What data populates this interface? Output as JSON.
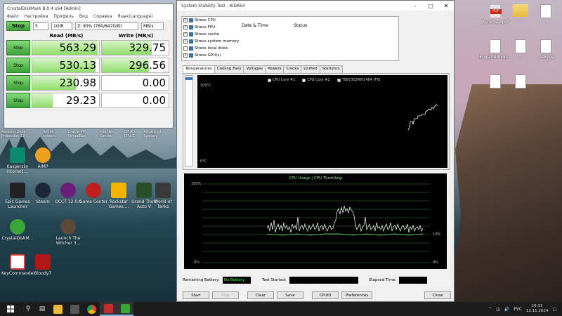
{
  "desktop": {
    "icons_left": [
      {
        "label": "Kaspersky Internet ...",
        "color": "#0a8a6a",
        "icon": "kaspersky-icon"
      },
      {
        "label": "AIMP",
        "color": "#f0a020",
        "icon": "aimp-icon"
      },
      {
        "label": "Epic Games Launcher",
        "color": "#222222",
        "icon": "epic-games-icon"
      },
      {
        "label": "Steam",
        "color": "#1b2838",
        "icon": "steam-icon"
      },
      {
        "label": "OCCT 12.0.0",
        "color": "#6b1f7a",
        "icon": "occt-icon"
      },
      {
        "label": "Game Center",
        "color": "#c02020",
        "icon": "game-center-icon"
      },
      {
        "label": "Rockstar Games ...",
        "color": "#f2b300",
        "icon": "rockstar-icon"
      },
      {
        "label": "Grand Theft Auto V",
        "color": "#2a4d2a",
        "icon": "gta-icon"
      },
      {
        "label": "World of Tanks",
        "color": "#3a3a3a",
        "icon": "wot-icon"
      },
      {
        "label": "CrystalDiskM...",
        "color": "#3aa63a",
        "icon": "crystaldiskmark-icon"
      },
      {
        "label": "Launch The Witcher 3...",
        "color": "#5a4a3a",
        "icon": "witcher-icon"
      },
      {
        "label": "KeyCommander...",
        "color": "#d84040",
        "icon": "keycommander-icon"
      },
      {
        "label": "Bloody7",
        "color": "#b01818",
        "icon": "bloody-icon"
      }
    ],
    "top_row_labels": [
      "Amazon Desk Protection 12",
      "Ashell ... system",
      "Oracle VM VirtualBox",
      "Intel Arc Control",
      "CPUID CPU-Z",
      "Advanced System..."
    ],
    "icons_right": [
      {
        "label": "Купить...pdf",
        "type": "pdf"
      },
      {
        "label": "...",
        "type": "folder"
      },
      {
        "label": "...",
        "type": "file"
      },
      {
        "label": "Epic2ndShop...",
        "type": "file"
      },
      {
        "label": "...",
        "type": "file"
      },
      {
        "label": "...skype",
        "type": "file"
      },
      {
        "label": "...",
        "type": "file"
      },
      {
        "label": "...",
        "type": "file"
      }
    ]
  },
  "cdm": {
    "title": "CrystalDiskMark 8.0.4 x64 [Admin]",
    "menu": [
      "Файл",
      "Настройки",
      "Профиль",
      "Вид",
      "Справка",
      "Язык(Language)"
    ],
    "stop_label": "Stop",
    "count": "5",
    "size": "1GiB",
    "drive": "Z: 90% (780/847GiB)",
    "unit": "MB/s",
    "read_header": "Read (MB/s)",
    "write_header": "Write (MB/s)",
    "rows": [
      {
        "label": "Stop",
        "read": "563.29",
        "write": "329.75",
        "read_pct": 0.98,
        "write_pct": 0.75
      },
      {
        "label": "Stop",
        "read": "530.13",
        "write": "296.56",
        "read_pct": 0.95,
        "write_pct": 0.7
      },
      {
        "label": "Stop",
        "read": "230.98",
        "write": "0.00",
        "read_pct": 0.65,
        "write_pct": 0.0
      },
      {
        "label": "Stop",
        "read": "29.23",
        "write": "0.00",
        "read_pct": 0.3,
        "write_pct": 0.0
      }
    ]
  },
  "ast": {
    "title": "System Stability Test - AIDA64",
    "tests": [
      "Stress CPU",
      "Stress FPU",
      "Stress cache",
      "Stress system memory",
      "Stress local disks",
      "Stress GPU(s)"
    ],
    "col_date": "Date & Time",
    "col_status": "Status",
    "tabs": [
      "Temperatures",
      "Cooling Fans",
      "Voltages",
      "Powers",
      "Clocks",
      "Unified",
      "Statistics"
    ],
    "legend": [
      "CPU Core #1",
      "CPU Core #2",
      "TSB7302MH1484 (F5)"
    ],
    "temp_top": "100°C",
    "temp_bottom": "0°C",
    "cpu_title_a": "CPU Usage",
    "cpu_title_sep": "|",
    "cpu_title_b": "CPU Throttling",
    "cpu_top": "100%",
    "cpu_bottom": "0%",
    "cpu_right_top": "0%",
    "cpu_right_mid": "13%",
    "remaining_battery_label": "Remaining Battery:",
    "remaining_battery_value": "No Battery",
    "test_started_label": "Test Started:",
    "elapsed_time_label": "Elapsed Time:",
    "buttons": [
      "Start",
      "Stop",
      "Clear",
      "Save",
      "CPUID",
      "Preferences",
      "Close"
    ]
  },
  "taskbar": {
    "apps": [
      {
        "name": "start",
        "icon": "windows-icon"
      },
      {
        "name": "search",
        "icon": "search-icon"
      },
      {
        "name": "task-view",
        "icon": "task-view-icon"
      },
      {
        "name": "explorer",
        "icon": "folder-icon",
        "color": "#e8b93e"
      },
      {
        "name": "calculator",
        "icon": "calculator-icon",
        "color": "#444"
      },
      {
        "name": "chrome",
        "icon": "chrome-icon",
        "color": "#4a8df0"
      },
      {
        "name": "aida64",
        "icon": "aida64-icon",
        "color": "#c03030"
      },
      {
        "name": "crystaldiskmark",
        "icon": "crystaldiskmark-icon",
        "color": "#3aa63a"
      }
    ],
    "lang": "РУС",
    "time": "16:31",
    "date": "12.11.2024"
  }
}
